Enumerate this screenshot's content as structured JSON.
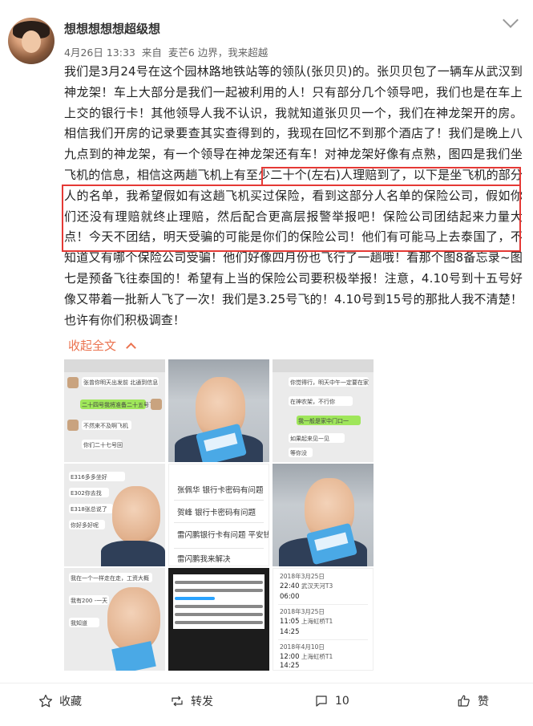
{
  "user": {
    "name": "想想想想想超级想"
  },
  "meta": {
    "date": "4月26日 13:33",
    "source_prefix": "来自",
    "source": "麦芒6 边界，我来超越"
  },
  "post": {
    "text": "我们是3月24号在这个园林路地铁站等的领队(张贝贝)的。张贝贝包了一辆车从武汉到神龙架！车上大部分是我们一起被利用的人！只有部分几个领导吧，我们也是在车上上交的银行卡！其他领导人我不认识，我就知道张贝贝一个，我们在神龙架开的房。相信我们开房的记录要查其实查得到的，我现在回忆不到那个酒店了！我们是晚上八九点到的神龙架，有一个领导在神龙架还有车！对神龙架好像有点熟，图四是我们坐飞机的信息，相信这两趟飞机上有至少二十个(左右)人理赔到了，以下是坐飞机的部分人的名单，我希望假如有这趟飞机买过保险，看到这部分人名单的保险公司，假如你们还没有理赔就终止理赔，然后配合更高层报警举报吧！保险公司团结起来力量大点！今天不团结，明天受骗的可能是你们的保险公司！他们有可能马上去泰国了，不知道又有哪个保险公司受骗！他们好像四月份也飞行了一趟哦！看那个图8备忘录~图七是预备飞往泰国的！希望有上当的保险公司要积极举报！注意，4.10号到十五号好像又带着一批新人飞了一次！我们是3.25号飞的！4.10号到15号的那批人我不清楚！也许有你们积极调查！",
    "collapse_label": "收起全文"
  },
  "images": {
    "chat1": [
      "张曾你明天出发前 北通到信息",
      "二十四号我将准备二十五号飞",
      "不然来不及啊飞机",
      "你们二十七号回"
    ],
    "chat3": [
      "你觉得行，明天中午一定要在家",
      "在神农架，不行你",
      "我一般是家中门口一",
      "如果起来见一见",
      "等你没"
    ],
    "chat4": [
      "E316多多坐好",
      "E302你去找",
      "E318张总说了",
      "你好多好呢"
    ],
    "memo": {
      "lines": [
        "张佩华 银行卡密码有问题",
        "贺峰 银行卡密码有问题",
        "雷闪鹏银行卡有问题 平安钱打不进来",
        "雷闪鹏我来解决"
      ]
    },
    "chat9": [
      "我在一个一样走在走，工资大概",
      "我有200 -一天",
      "我知道"
    ],
    "trips": [
      {
        "date": "2018年3月25日",
        "from": "22:40",
        "to": "06:00",
        "label": "武汉天河T3"
      },
      {
        "date": "2018年3月25日",
        "from": "11:05",
        "to": "14:25",
        "label": "上海虹桥T1"
      },
      {
        "date": "2018年4月10日",
        "from": "12:00",
        "to": "14:25",
        "label": "上海虹桥T1"
      }
    ]
  },
  "footer": {
    "favorite": "收藏",
    "repost": "转发",
    "comments": "10",
    "like": "赞"
  }
}
